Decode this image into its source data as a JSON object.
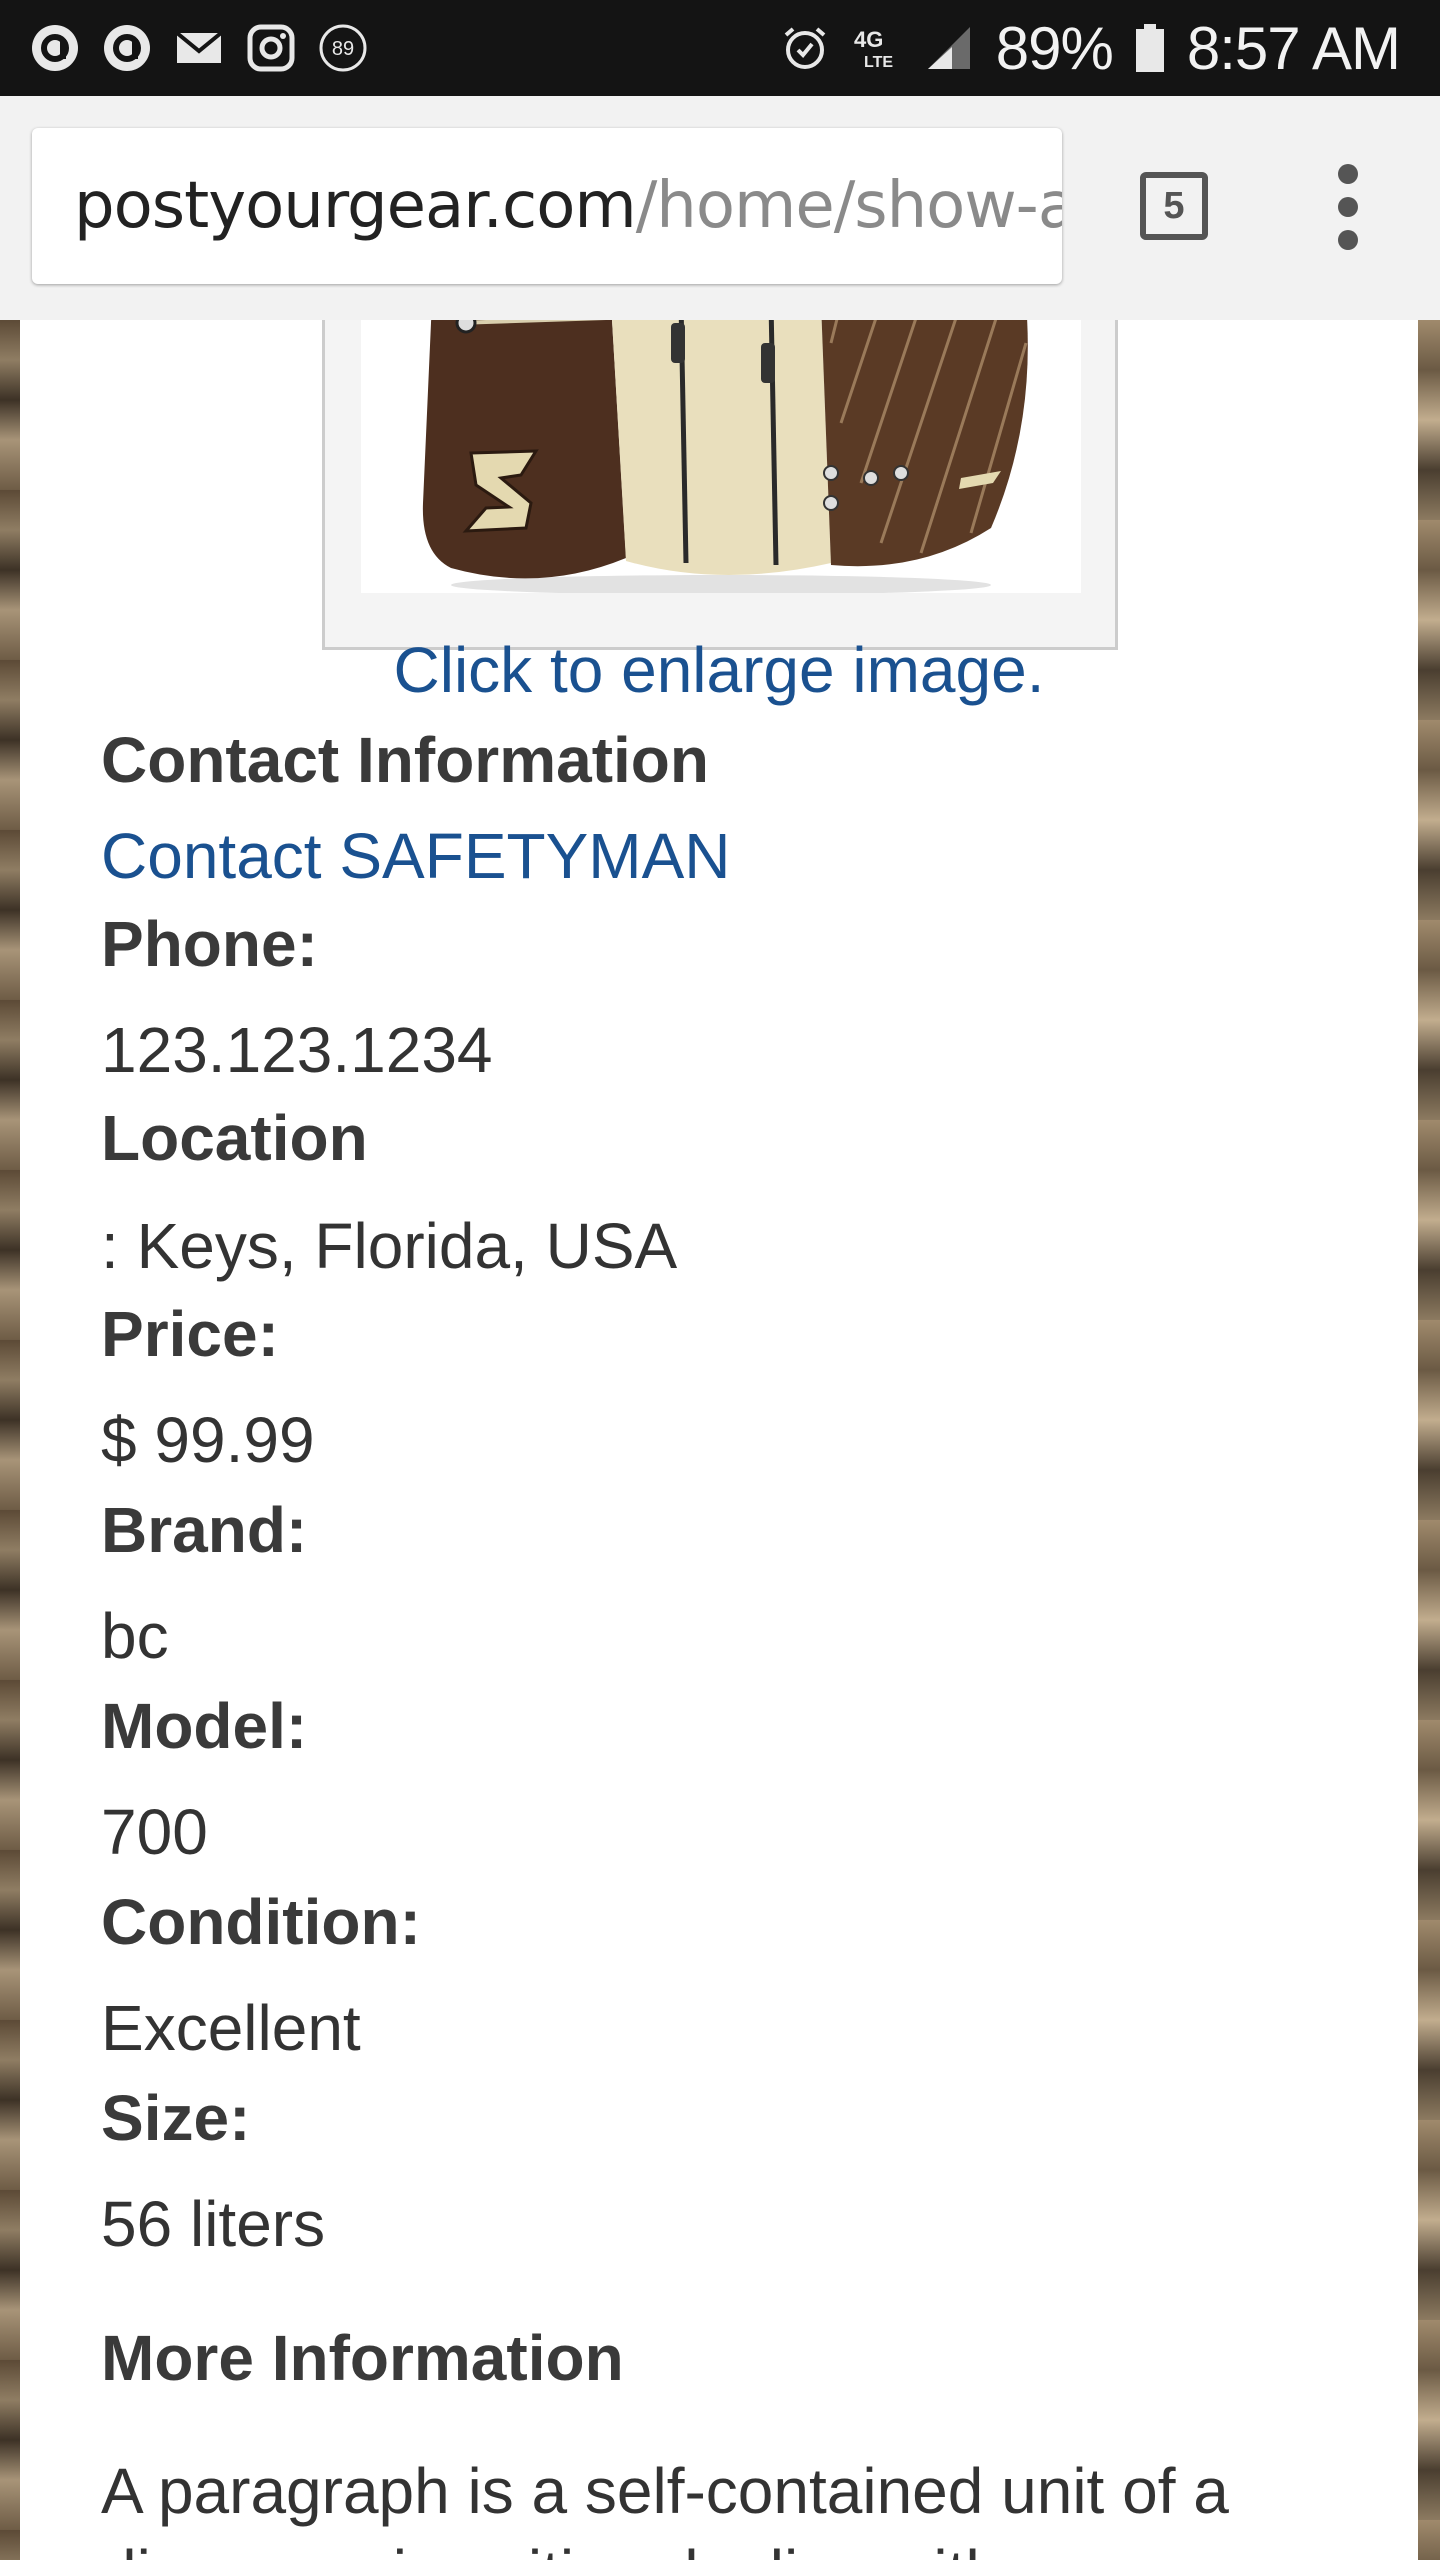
{
  "status_bar": {
    "notification_icons": [
      "app-icon-a",
      "app-icon-a",
      "mail-icon",
      "instagram-icon",
      "badge-89-icon"
    ],
    "badge_count": "89",
    "network_label": "4G LTE",
    "battery_percent": "89%",
    "time": "8:57 AM"
  },
  "browser": {
    "url_host": "postyourgear.com",
    "url_path": "/home/show-ac",
    "tab_count": "5",
    "menu_icon": "overflow-menu-icon"
  },
  "listing": {
    "enlarge_label": "Click to enlarge image.",
    "contact_heading": "Contact Information",
    "contact_link": "Contact SAFETYMAN",
    "phone_label": "Phone:",
    "phone_value": "123.123.1234",
    "location_label": "Location",
    "location_value": ": Keys, Florida, USA",
    "price_label": "Price:",
    "price_value": "$ 99.99",
    "brand_label": "Brand:",
    "brand_value": "bc",
    "model_label": "Model:",
    "model_value": "700",
    "condition_label": "Condition:",
    "condition_value": "Excellent",
    "size_label": "Size:",
    "size_value": "56 liters",
    "more_info_heading": "More Information",
    "more_info_text": "A paragraph is a self-contained unit of a discourse in writing dealing with a"
  },
  "colors": {
    "link": "#1a5190",
    "status_bar": "#141414",
    "toolbar": "#f2f2f2"
  }
}
